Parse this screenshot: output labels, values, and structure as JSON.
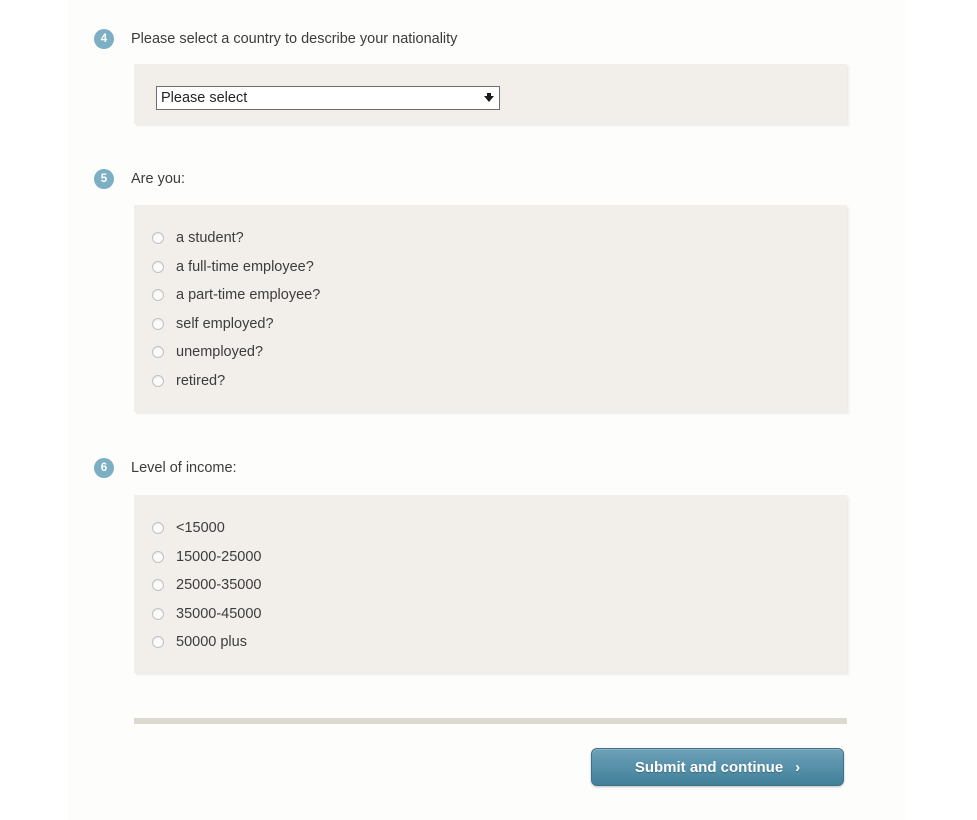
{
  "page": {
    "background_color": "#ffffff",
    "panel_color": "#f2efeb",
    "accent_color": "#7cafc4",
    "button_color": "#5992ab",
    "divider_color": "#dcd9d1"
  },
  "questions": [
    {
      "number": "4",
      "label": "Please select a country to describe your nationality",
      "type": "select",
      "select": {
        "value": "Please select",
        "placeholder": "Please select",
        "arrow_icon": "chevron-down-icon"
      }
    },
    {
      "number": "5",
      "label": "Are you:",
      "type": "radio-group",
      "options": [
        {
          "label": "a student?",
          "checked": false
        },
        {
          "label": "a full-time employee?",
          "checked": false
        },
        {
          "label": "a part-time employee?",
          "checked": false
        },
        {
          "label": "self employed?",
          "checked": false
        },
        {
          "label": "unemployed?",
          "checked": false
        },
        {
          "label": "retired?",
          "checked": false
        }
      ]
    },
    {
      "number": "6",
      "label": "Level of income:",
      "type": "radio-group",
      "options": [
        {
          "label": "<15000",
          "checked": false
        },
        {
          "label": "15000-25000",
          "checked": false
        },
        {
          "label": "25000-35000",
          "checked": false
        },
        {
          "label": "35000-45000",
          "checked": false
        },
        {
          "label": "50000 plus",
          "checked": false
        }
      ]
    }
  ],
  "footer": {
    "submit_label": "Submit and continue",
    "submit_chevron": "›"
  }
}
